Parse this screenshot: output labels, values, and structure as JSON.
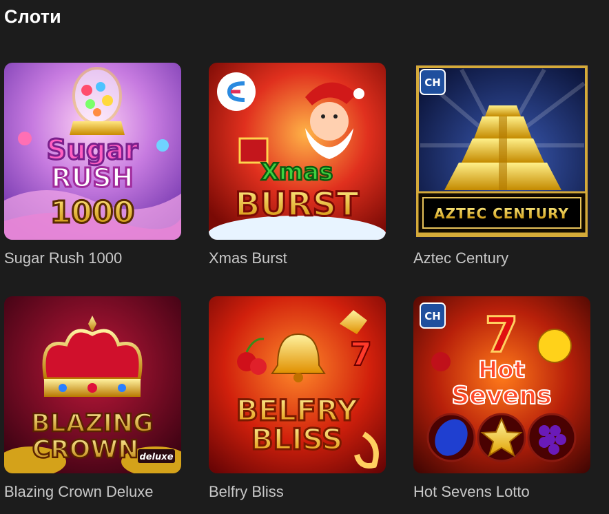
{
  "section": {
    "title": "Слоти"
  },
  "games": [
    {
      "title": "Sugar Rush 1000",
      "logo": [
        "Sugar",
        "RUSH",
        "1000"
      ]
    },
    {
      "title": "Xmas Burst",
      "logo": [
        "Xmas",
        "BURST"
      ]
    },
    {
      "title": "Aztec Century",
      "logo": [
        "AZTEC CENTURY"
      ],
      "badge": "CH"
    },
    {
      "title": "Blazing Crown Deluxe",
      "logo": [
        "BLAZING",
        "CROWN",
        "deluxe"
      ]
    },
    {
      "title": "Belfry Bliss",
      "logo": [
        "BELFRY",
        "BLISS"
      ]
    },
    {
      "title": "Hot Sevens Lotto",
      "logo": [
        "7",
        "Hot",
        "Sevens"
      ],
      "badge": "CH"
    }
  ],
  "colors": {
    "background": "#1c1c1c",
    "title_text": "#ffffff",
    "card_text": "#c8c8c8"
  }
}
